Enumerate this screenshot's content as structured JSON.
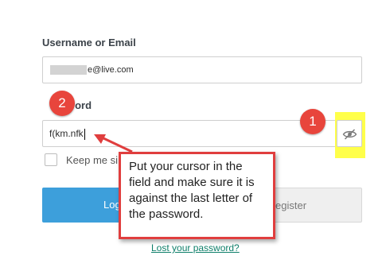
{
  "form": {
    "username_label": "Username or Email",
    "username_value_visible": "e@live.com",
    "password_label_visible": "word",
    "password_value": "f(km.nfk",
    "remember_label_visible": "Keep me si",
    "login_label_visible": "Log",
    "register_label_visible": "egister",
    "lost_password": "Lost your password?"
  },
  "annotations": {
    "badge_1": "1",
    "badge_2": "2",
    "callout_text": "Put your cursor in the field and make sure it is against the last letter of the password."
  },
  "colors": {
    "badge": "#e8453c",
    "callout_border": "#e03e3e",
    "highlight": "#ffff4a",
    "login_button": "#3d9fdb"
  },
  "icons": {
    "visibility_toggle": "eye-slash-icon"
  }
}
